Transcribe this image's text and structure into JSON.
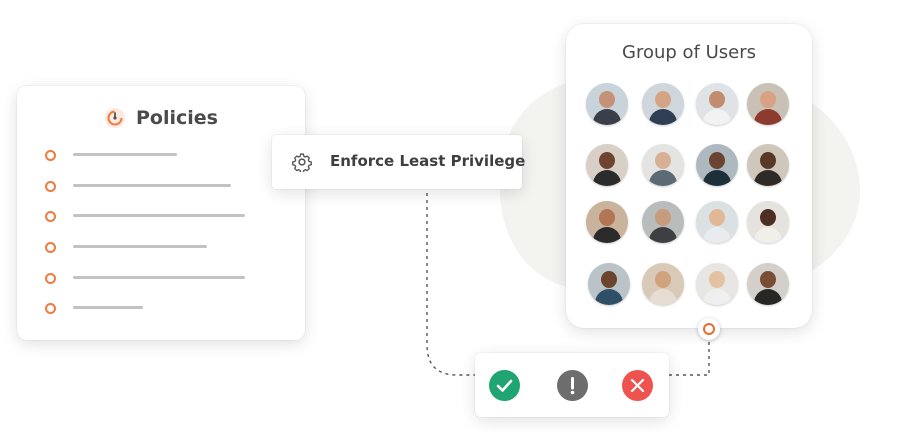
{
  "policies": {
    "title": "Policies",
    "rows": 6
  },
  "enforce": {
    "label": "Enforce Least Privilege",
    "icon": "gear-icon"
  },
  "group": {
    "title": "Group of Users",
    "avatar_count": 16
  },
  "status": {
    "icons": [
      "check-icon",
      "exclamation-icon",
      "close-icon"
    ],
    "colors": {
      "success": "#1fa571",
      "warning": "#6d6d6d",
      "error": "#ef5350"
    }
  },
  "colors": {
    "accent": "#ef7b3f",
    "line": "#c2c2c2",
    "text": "#4a4a4a"
  }
}
